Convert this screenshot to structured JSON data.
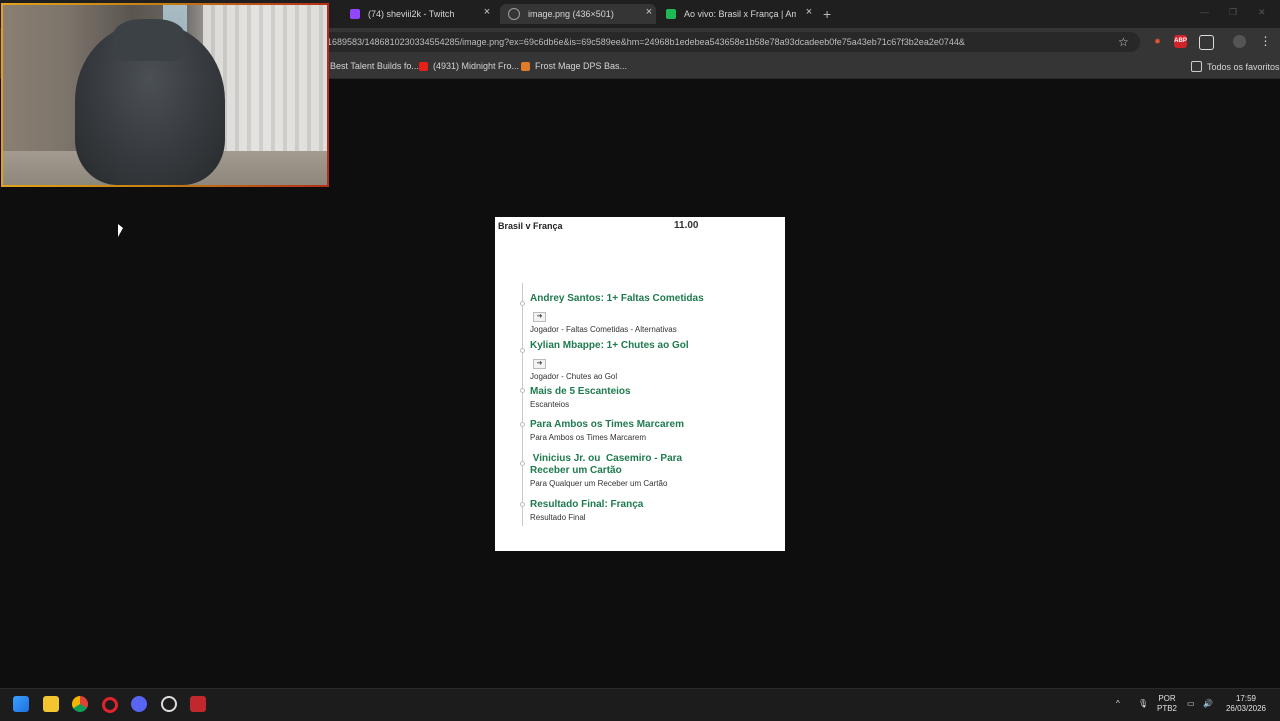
{
  "tabs": [
    {
      "label": "(74) sheviii2k - Twitch",
      "favicon": "twitch-icon",
      "color": "#9146ff"
    },
    {
      "label": "image.png (436×501)",
      "favicon": "globe-icon",
      "color": "#9aa0a6"
    },
    {
      "label": "Ao vivo: Brasil x França | Amisto",
      "favicon": "live-icon",
      "color": "#1db954"
    }
  ],
  "new_tab": "+",
  "close_glyph": "×",
  "address_bar": {
    "url": "1689583/1486810230334554285/image.png?ex=69c6db6e&is=69c589ee&hm=24968b1edebea543658e1b58e78a93dcadeeb0fe75a43eb71c67f3b2ea2e0744&"
  },
  "extensions": [
    "puzzle-icon",
    "abp-icon",
    "extensions-icon",
    "profile-icon",
    "menu-icon"
  ],
  "bookmarks": [
    {
      "label": "Best Talent Builds fo..."
    },
    {
      "label": "(4931) Midnight Fro..."
    },
    {
      "label": "Frost Mage DPS Bas..."
    }
  ],
  "bookmarks_all": "Todos os favoritos",
  "bet_slip": {
    "match": "Brasil v França",
    "odds": "11.00",
    "selections": [
      {
        "title": "Andrey Santos: 1+ Faltas Cometidas",
        "sub": "Jogador - Faltas Cometidas - Alternativas",
        "has_arrow": true
      },
      {
        "title": "Kylian Mbappe: 1+ Chutes ao Gol",
        "sub": "Jogador - Chutes ao Gol",
        "has_arrow": true
      },
      {
        "title": "Mais de 5 Escanteios",
        "sub": "Escanteios",
        "has_arrow": false
      },
      {
        "title": "Para Ambos os Times Marcarem",
        "sub": "Para Ambos os Times Marcarem",
        "has_arrow": false
      },
      {
        "title": " Vinicius Jr. ou  Casemiro - Para Receber um Cartão",
        "sub": "Para Qualquer um Receber um Cartão",
        "has_arrow": false
      },
      {
        "title": "Resultado Final: França",
        "sub": "Resultado Final",
        "has_arrow": false
      }
    ],
    "accent_color": "#1f7b4d"
  },
  "taskbar": {
    "apps": [
      "windows-start-icon",
      "file-explorer-icon",
      "chrome-icon",
      "opera-icon",
      "discord-icon",
      "obs-icon",
      "voicemeeter-icon"
    ],
    "lang_line1": "POR",
    "lang_line2": "PTB2",
    "time": "17:59",
    "date": "26/03/2026"
  }
}
